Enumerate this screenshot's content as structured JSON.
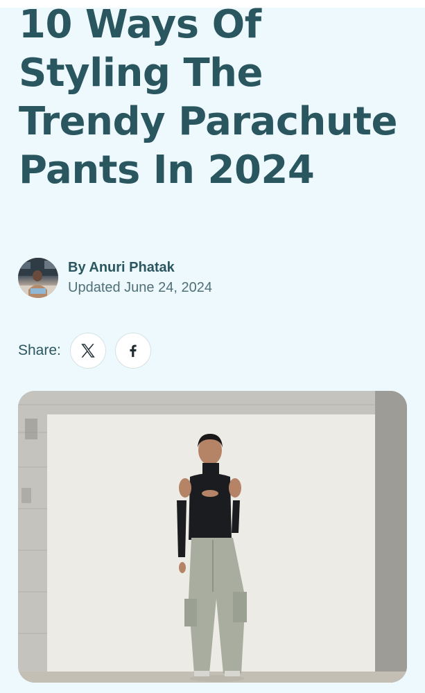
{
  "article": {
    "title": "10 Ways Of Styling The Trendy Parachute Pants In 2024",
    "author": "By Anuri Phatak",
    "updated": "Updated June 24, 2024"
  },
  "share": {
    "label": "Share:",
    "buttons": [
      {
        "icon": "x-icon",
        "network": "X"
      },
      {
        "icon": "facebook-icon",
        "network": "Facebook"
      }
    ]
  },
  "colors": {
    "page_background": "#eef9fd",
    "title": "#2a5660",
    "muted_text": "#4f6f77"
  }
}
